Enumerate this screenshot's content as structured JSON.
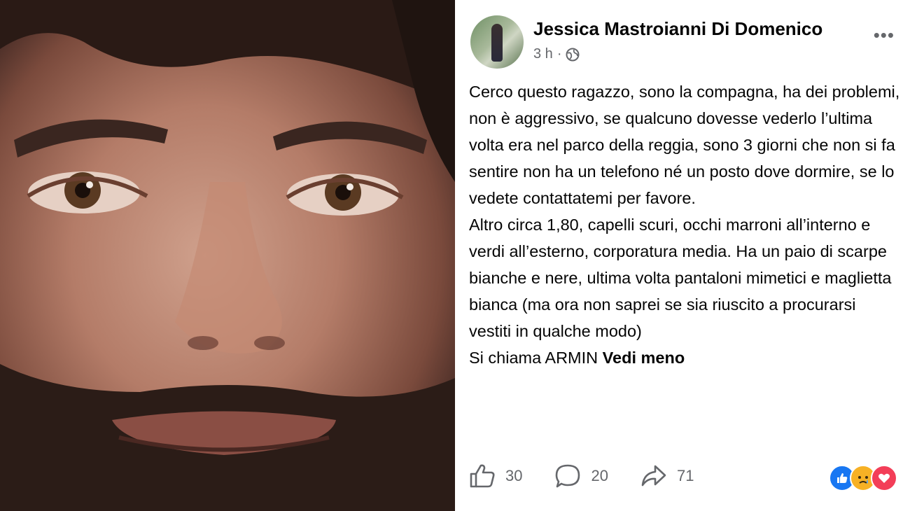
{
  "post": {
    "author": "Jessica Mastroianni Di Domenico",
    "time": "3 h",
    "separator": "·",
    "privacy_icon": "globe-icon",
    "more_label": "•••",
    "paragraphs": [
      "Cerco questo ragazzo, sono la compagna, ha dei problemi, non è aggressivo, se qualcuno dovesse vederlo l’ultima volta era nel parco della reggia, sono 3 giorni che non si fa sentire non ha un telefono né un posto dove dormire, se lo vedete contattatemi per favore.",
      "Altro circa 1,80, capelli scuri, occhi marroni all’interno e verdi all’esterno, corporatura media. Ha un paio di scarpe bianche e nere, ultima volta pantaloni mimetici e maglietta bianca (ma ora non saprei se sia riuscito a procurarsi vestiti in qualche modo)"
    ],
    "last_line": "Si chiama ARMIN ",
    "see_less": "Vedi meno"
  },
  "actions": {
    "likes": "30",
    "comments": "20",
    "shares": "71"
  },
  "reactions": [
    "like",
    "sad",
    "love"
  ],
  "colors": {
    "text": "#050505",
    "secondary": "#65676b",
    "like_blue": "#1877f2",
    "love_red": "#f33e58",
    "sad_yellow": "#f7b125"
  }
}
